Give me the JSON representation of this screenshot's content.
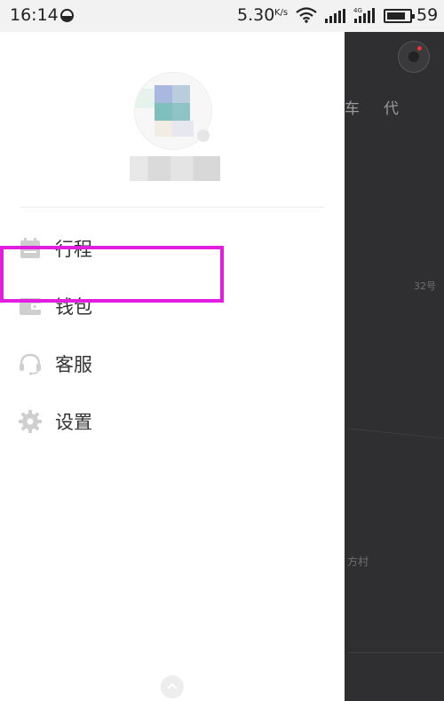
{
  "status_bar": {
    "time": "16:14",
    "net_speed": "5.30",
    "net_speed_unit": "K/s",
    "battery": "59",
    "signal_label": "4G"
  },
  "background": {
    "tab_partial_1": "车",
    "tab_partial_2": "代",
    "map_label_1": "32号",
    "map_label_2": "方村"
  },
  "drawer": {
    "menu": [
      {
        "label": "行程",
        "icon": "calendar-icon"
      },
      {
        "label": "钱包",
        "icon": "wallet-icon"
      },
      {
        "label": "客服",
        "icon": "headset-icon"
      },
      {
        "label": "设置",
        "icon": "gear-icon"
      }
    ]
  },
  "colors": {
    "highlight": "#e31ee0",
    "icon": "#cfcfcf",
    "drawer_bg": "#ffffff",
    "map_bg": "#2b2b2d"
  }
}
